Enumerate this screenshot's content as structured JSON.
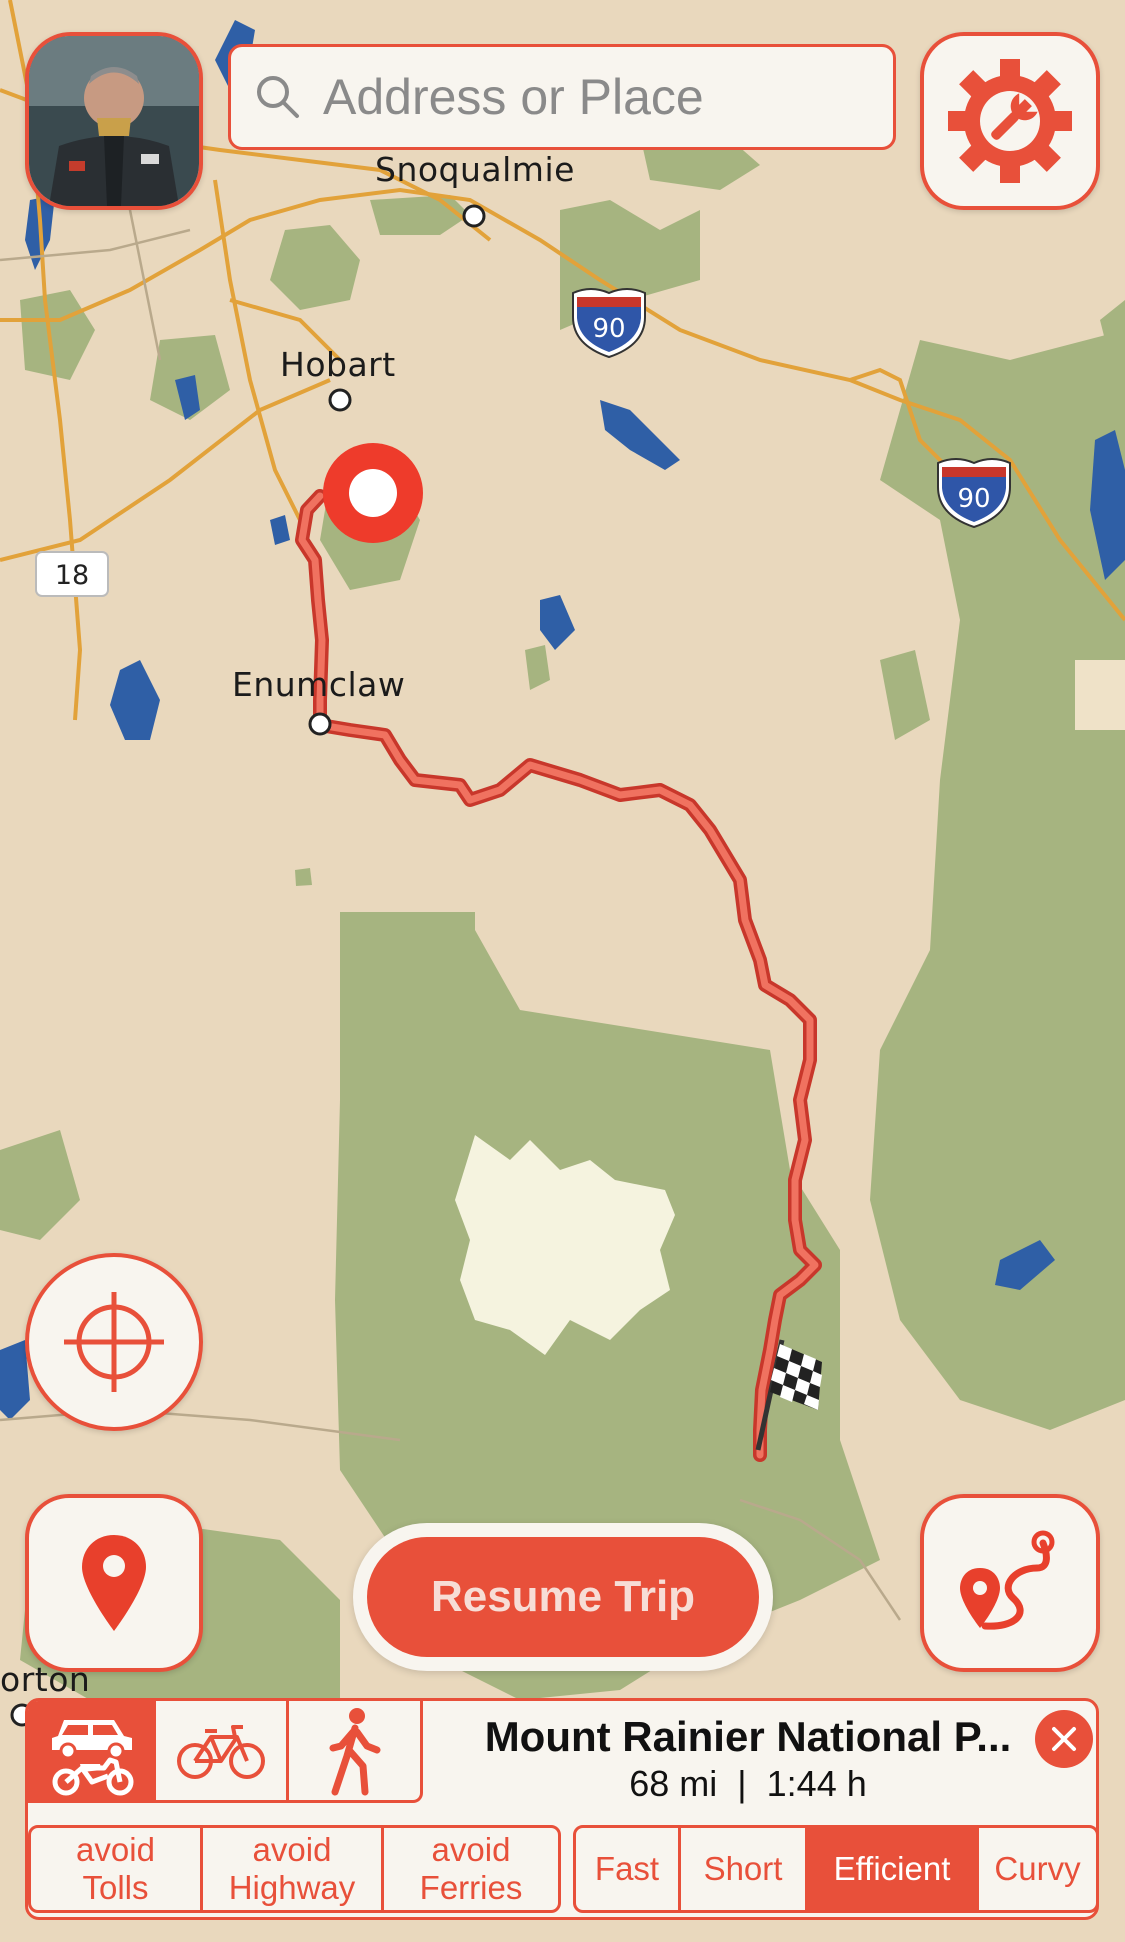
{
  "search": {
    "placeholder": "Address or Place"
  },
  "map": {
    "places": {
      "snoqualmie": "Snoqualmie",
      "hobart": "Hobart",
      "enumclaw": "Enumclaw",
      "orton": "orton"
    },
    "shields": {
      "i90_a": "90",
      "i90_b": "90",
      "sr18": "18"
    }
  },
  "buttons": {
    "resume_trip": "Resume Trip"
  },
  "trip": {
    "destination": "Mount Rainier National P...",
    "distance": "68 mi",
    "separator": "|",
    "duration": "1:44 h"
  },
  "travel_modes": [
    {
      "name": "car-motorcycle",
      "active": true
    },
    {
      "name": "bicycle",
      "active": false
    },
    {
      "name": "walking",
      "active": false
    }
  ],
  "avoid_options": [
    {
      "label": "avoid\nTolls"
    },
    {
      "label": "avoid\nHighway"
    },
    {
      "label": "avoid\nFerries"
    }
  ],
  "route_profiles": [
    {
      "label": "Fast",
      "active": false
    },
    {
      "label": "Short",
      "active": false
    },
    {
      "label": "Efficient",
      "active": true
    },
    {
      "label": "Curvy",
      "active": false
    }
  ],
  "colors": {
    "accent": "#e8503a",
    "land": "#e9d8bd",
    "forest": "#a6b480",
    "snow": "#f5f3df",
    "water": "#2f5fa6",
    "road": "#e2a23a"
  },
  "icons": {
    "settings": "gear-wrench-icon",
    "locate": "crosshair-icon",
    "pin": "map-pin-icon",
    "route": "route-icon",
    "finish": "checkered-flag-icon",
    "close": "close-icon"
  }
}
